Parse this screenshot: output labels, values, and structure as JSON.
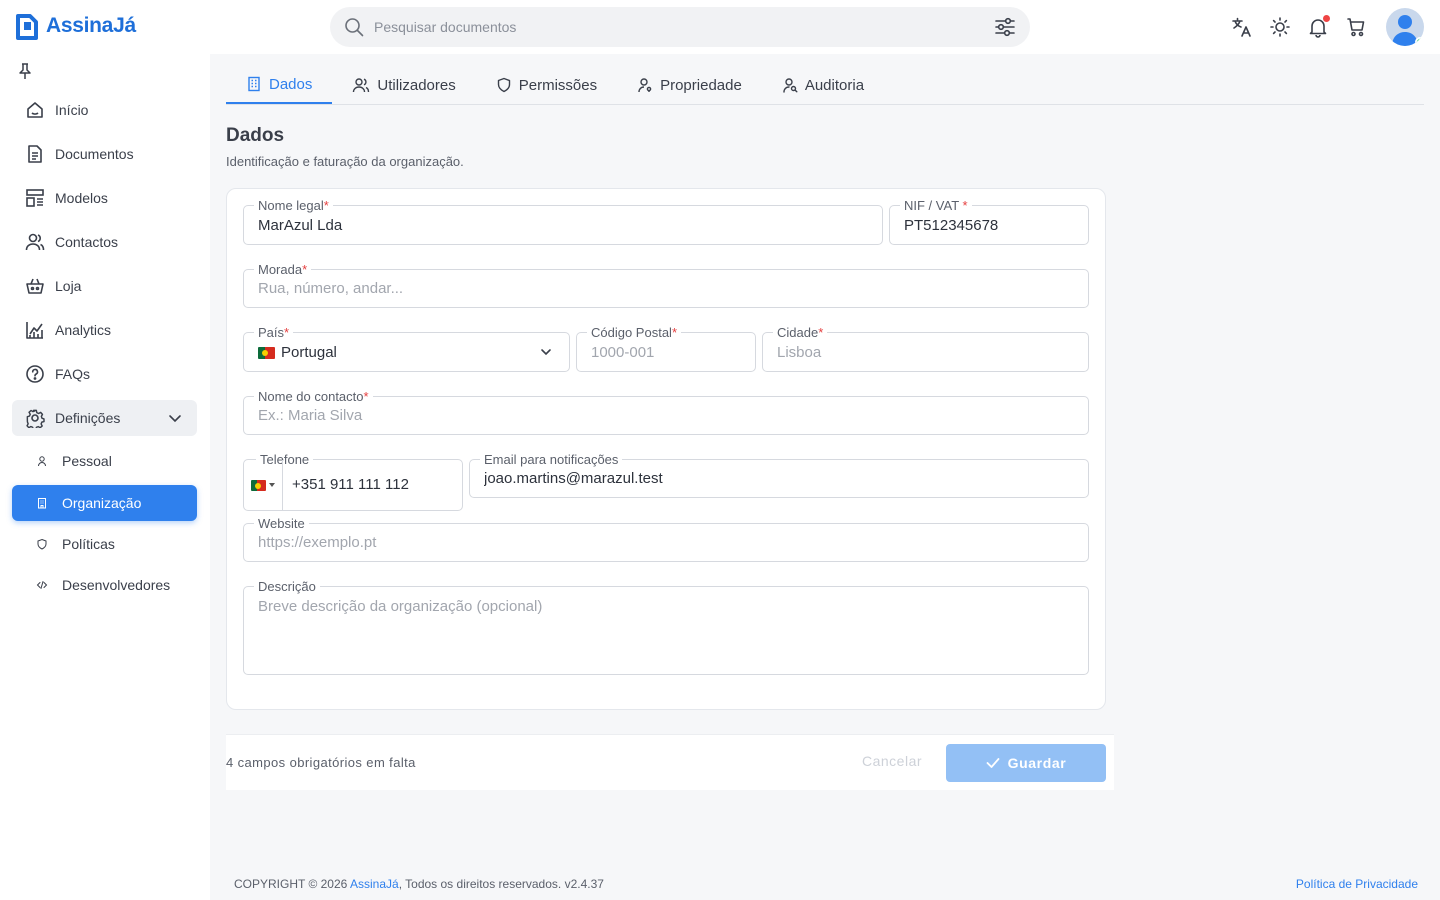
{
  "app": {
    "name": "AssinaJá",
    "accent": "#2f80ed"
  },
  "search": {
    "placeholder": "Pesquisar documentos"
  },
  "sidebar": {
    "items": [
      {
        "label": "Início",
        "icon": "home-icon"
      },
      {
        "label": "Documentos",
        "icon": "document-icon"
      },
      {
        "label": "Modelos",
        "icon": "template-icon"
      },
      {
        "label": "Contactos",
        "icon": "contacts-icon"
      },
      {
        "label": "Loja",
        "icon": "shop-basket-icon"
      },
      {
        "label": "Analytics",
        "icon": "chart-icon"
      },
      {
        "label": "FAQs",
        "icon": "help-icon"
      },
      {
        "label": "Definições",
        "icon": "settings-icon"
      }
    ],
    "subitems": [
      {
        "label": "Pessoal",
        "icon": "user-icon"
      },
      {
        "label": "Organização",
        "icon": "building-icon",
        "active": true
      },
      {
        "label": "Políticas",
        "icon": "shield-icon"
      },
      {
        "label": "Desenvolvedores",
        "icon": "code-icon"
      }
    ]
  },
  "tabs": [
    {
      "label": "Dados",
      "icon": "building-icon",
      "active": true
    },
    {
      "label": "Utilizadores",
      "icon": "users-icon"
    },
    {
      "label": "Permissões",
      "icon": "shield-icon"
    },
    {
      "label": "Propriedade",
      "icon": "user-key-icon"
    },
    {
      "label": "Auditoria",
      "icon": "user-search-icon"
    }
  ],
  "page": {
    "title": "Dados",
    "subtitle": "Identificação e faturação da organização."
  },
  "form": {
    "legal_name": {
      "label": "Nome legal",
      "value": "MarAzul Lda"
    },
    "vat": {
      "label": "NIF / VAT",
      "value": "PT512345678"
    },
    "address": {
      "label": "Morada",
      "placeholder": "Rua, número, andar..."
    },
    "country": {
      "label": "País",
      "value": "Portugal"
    },
    "postal_code": {
      "label": "Código Postal",
      "placeholder": "1000-001"
    },
    "city": {
      "label": "Cidade",
      "placeholder": "Lisboa"
    },
    "contact_name": {
      "label": "Nome do contacto",
      "placeholder": "Ex.: Maria Silva"
    },
    "phone": {
      "label": "Telefone",
      "value": "+351 911 111 112"
    },
    "email": {
      "label": "Email para notificações",
      "value": "joao.martins@marazul.test"
    },
    "website": {
      "label": "Website",
      "placeholder": "https://exemplo.pt"
    },
    "description": {
      "label": "Descrição",
      "placeholder": "Breve descrição da organização (opcional)"
    },
    "required_mark": "*"
  },
  "actions": {
    "missing": "4 campos obrigatórios em falta",
    "cancel": "Cancelar",
    "save": "Guardar"
  },
  "footer": {
    "copyright_prefix": "COPYRIGHT © 2026",
    "brand": "AssinaJá",
    "rights": ", Todos os direitos reservados.",
    "version": "v2.4.37",
    "privacy": "Política de Privacidade"
  }
}
